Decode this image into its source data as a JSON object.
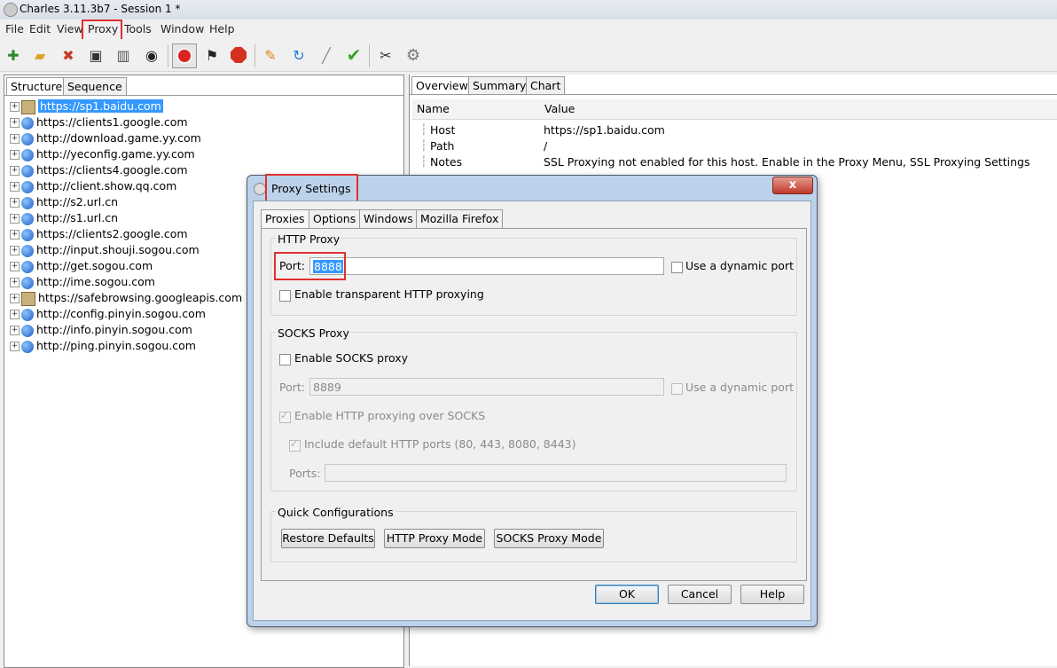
{
  "window": {
    "title": "Charles 3.11.3b7 - Session 1 *"
  },
  "menu": [
    "File",
    "Edit",
    "View",
    "Proxy",
    "Tools",
    "Window",
    "Help"
  ],
  "toolbar": [
    "new-session-icon",
    "open-icon",
    "close-session-icon",
    "save-icon",
    "clear-icon",
    "find-icon",
    "record-icon",
    "throttle-icon",
    "stop-icon",
    "compose-icon",
    "repeat-icon",
    "edit-icon",
    "validate-icon",
    "tools-icon",
    "settings-icon"
  ],
  "left_panel": {
    "tabs": [
      "Structure",
      "Sequence"
    ],
    "tree": [
      {
        "label": "https://sp1.baidu.com",
        "icon": "lock",
        "selected": true
      },
      {
        "label": "https://clients1.google.com",
        "icon": "globe"
      },
      {
        "label": "http://download.game.yy.com",
        "icon": "globe"
      },
      {
        "label": "http://yeconfig.game.yy.com",
        "icon": "globe"
      },
      {
        "label": "https://clients4.google.com",
        "icon": "globe"
      },
      {
        "label": "http://client.show.qq.com",
        "icon": "globe"
      },
      {
        "label": "http://s2.url.cn",
        "icon": "globe"
      },
      {
        "label": "http://s1.url.cn",
        "icon": "globe"
      },
      {
        "label": "https://clients2.google.com",
        "icon": "globe"
      },
      {
        "label": "http://input.shouji.sogou.com",
        "icon": "globe"
      },
      {
        "label": "http://get.sogou.com",
        "icon": "globe"
      },
      {
        "label": "http://ime.sogou.com",
        "icon": "globe"
      },
      {
        "label": "https://safebrowsing.googleapis.com",
        "icon": "lock"
      },
      {
        "label": "http://config.pinyin.sogou.com",
        "icon": "globe"
      },
      {
        "label": "http://info.pinyin.sogou.com",
        "icon": "globe"
      },
      {
        "label": "http://ping.pinyin.sogou.com",
        "icon": "globe"
      }
    ]
  },
  "right_panel": {
    "tabs": [
      "Overview",
      "Summary",
      "Chart"
    ],
    "columns": [
      "Name",
      "Value"
    ],
    "rows": [
      {
        "name": "Host",
        "value": "https://sp1.baidu.com"
      },
      {
        "name": "Path",
        "value": "/"
      },
      {
        "name": "Notes",
        "value": "SSL Proxying not enabled for this host. Enable in the Proxy Menu, SSL Proxying Settings"
      }
    ]
  },
  "dialog": {
    "title": "Proxy Settings",
    "tabs": [
      "Proxies",
      "Options",
      "Windows",
      "Mozilla Firefox"
    ],
    "http_proxy": {
      "group_label": "HTTP Proxy",
      "port_label": "Port:",
      "port_value": "8888",
      "dynamic_port_label": "Use a dynamic port",
      "transparent_label": "Enable transparent HTTP proxying"
    },
    "socks_proxy": {
      "group_label": "SOCKS Proxy",
      "enable_label": "Enable SOCKS proxy",
      "port_label": "Port:",
      "port_value": "8889",
      "dynamic_port_label": "Use a dynamic port",
      "http_over_socks_label": "Enable HTTP proxying over SOCKS",
      "include_ports_label": "Include default HTTP ports (80, 443, 8080, 8443)",
      "ports_label": "Ports:",
      "ports_value": ""
    },
    "quick": {
      "group_label": "Quick Configurations",
      "restore": "Restore Defaults",
      "http_mode": "HTTP Proxy Mode",
      "socks_mode": "SOCKS Proxy Mode"
    },
    "buttons": {
      "ok": "OK",
      "cancel": "Cancel",
      "help": "Help"
    },
    "close_glyph": "x"
  }
}
